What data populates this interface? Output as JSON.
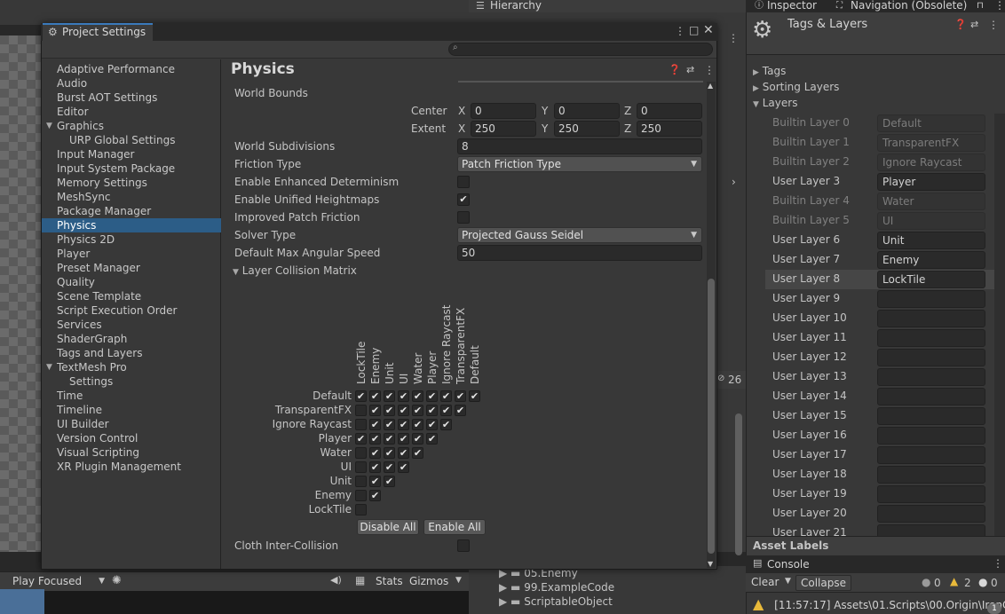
{
  "hierarchy": {
    "tab": "Hierarchy"
  },
  "inspector": {
    "tabs": [
      "Inspector",
      "Navigation (Obsolete)"
    ],
    "header_title": "Tags & Layers",
    "sections": [
      "Tags",
      "Sorting Layers",
      "Layers"
    ],
    "layers": [
      {
        "label": "Builtin Layer 0",
        "value": "Default",
        "builtin": true
      },
      {
        "label": "Builtin Layer 1",
        "value": "TransparentFX",
        "builtin": true
      },
      {
        "label": "Builtin Layer 2",
        "value": "Ignore Raycast",
        "builtin": true
      },
      {
        "label": "User Layer 3",
        "value": "Player",
        "builtin": false
      },
      {
        "label": "Builtin Layer 4",
        "value": "Water",
        "builtin": true
      },
      {
        "label": "Builtin Layer 5",
        "value": "UI",
        "builtin": true
      },
      {
        "label": "User Layer 6",
        "value": "Unit",
        "builtin": false
      },
      {
        "label": "User Layer 7",
        "value": "Enemy",
        "builtin": false
      },
      {
        "label": "User Layer 8",
        "value": "LockTile",
        "builtin": false
      },
      {
        "label": "User Layer 9",
        "value": "",
        "builtin": false
      },
      {
        "label": "User Layer 10",
        "value": "",
        "builtin": false
      },
      {
        "label": "User Layer 11",
        "value": "",
        "builtin": false
      },
      {
        "label": "User Layer 12",
        "value": "",
        "builtin": false
      },
      {
        "label": "User Layer 13",
        "value": "",
        "builtin": false
      },
      {
        "label": "User Layer 14",
        "value": "",
        "builtin": false
      },
      {
        "label": "User Layer 15",
        "value": "",
        "builtin": false
      },
      {
        "label": "User Layer 16",
        "value": "",
        "builtin": false
      },
      {
        "label": "User Layer 17",
        "value": "",
        "builtin": false
      },
      {
        "label": "User Layer 18",
        "value": "",
        "builtin": false
      },
      {
        "label": "User Layer 19",
        "value": "",
        "builtin": false
      },
      {
        "label": "User Layer 20",
        "value": "",
        "builtin": false
      },
      {
        "label": "User Layer 21",
        "value": "",
        "builtin": false
      }
    ],
    "highlighted_layer": "User Layer 8",
    "asset_labels": "Asset Labels"
  },
  "console": {
    "tab": "Console",
    "clear": "Clear",
    "collapse": "Collapse",
    "counts": {
      "info": "0",
      "warn": "2",
      "error": "0"
    },
    "entry": "[11:57:17] Assets\\01.Scripts\\00.Origin\\IronCo",
    "entry_count": "1"
  },
  "hierarchy_lower": {
    "count": "26"
  },
  "project_files": [
    "05.Enemy",
    "99.ExampleCode",
    "ScriptableObject"
  ],
  "game_toolbar": {
    "play_mode": "Play Focused",
    "stats": "Stats",
    "gizmos": "Gizmos"
  },
  "project_settings": {
    "window_title": "Project Settings",
    "search_placeholder": "",
    "nav": [
      {
        "label": "Adaptive Performance",
        "indent": 0
      },
      {
        "label": "Audio",
        "indent": 0
      },
      {
        "label": "Burst AOT Settings",
        "indent": 0
      },
      {
        "label": "Editor",
        "indent": 0
      },
      {
        "label": "Graphics",
        "indent": 0,
        "expandable": true
      },
      {
        "label": "URP Global Settings",
        "indent": 1
      },
      {
        "label": "Input Manager",
        "indent": 0
      },
      {
        "label": "Input System Package",
        "indent": 0
      },
      {
        "label": "Memory Settings",
        "indent": 0
      },
      {
        "label": "MeshSync",
        "indent": 0
      },
      {
        "label": "Package Manager",
        "indent": 0
      },
      {
        "label": "Physics",
        "indent": 0,
        "selected": true
      },
      {
        "label": "Physics 2D",
        "indent": 0
      },
      {
        "label": "Player",
        "indent": 0
      },
      {
        "label": "Preset Manager",
        "indent": 0
      },
      {
        "label": "Quality",
        "indent": 0
      },
      {
        "label": "Scene Template",
        "indent": 0
      },
      {
        "label": "Script Execution Order",
        "indent": 0
      },
      {
        "label": "Services",
        "indent": 0
      },
      {
        "label": "ShaderGraph",
        "indent": 0
      },
      {
        "label": "Tags and Layers",
        "indent": 0
      },
      {
        "label": "TextMesh Pro",
        "indent": 0,
        "expandable": true
      },
      {
        "label": "Settings",
        "indent": 1
      },
      {
        "label": "Time",
        "indent": 0
      },
      {
        "label": "Timeline",
        "indent": 0
      },
      {
        "label": "UI Builder",
        "indent": 0
      },
      {
        "label": "Version Control",
        "indent": 0
      },
      {
        "label": "Visual Scripting",
        "indent": 0
      },
      {
        "label": "XR Plugin Management",
        "indent": 0
      }
    ],
    "page_title": "Physics",
    "world_bounds": {
      "label": "World Bounds",
      "center_label": "Center",
      "extent_label": "Extent",
      "center": {
        "x": "0",
        "y": "0",
        "z": "0"
      },
      "extent": {
        "x": "250",
        "y": "250",
        "z": "250"
      }
    },
    "axes": {
      "x": "X",
      "y": "Y",
      "z": "Z"
    },
    "world_subdivisions": {
      "label": "World Subdivisions",
      "value": "8"
    },
    "friction_type": {
      "label": "Friction Type",
      "value": "Patch Friction Type"
    },
    "enhanced_determinism": {
      "label": "Enable Enhanced Determinism",
      "checked": false
    },
    "unified_heightmaps": {
      "label": "Enable Unified Heightmaps",
      "checked": true
    },
    "improved_patch_friction": {
      "label": "Improved Patch Friction",
      "checked": false
    },
    "solver_type": {
      "label": "Solver Type",
      "value": "Projected Gauss Seidel"
    },
    "max_angular_speed": {
      "label": "Default Max Angular Speed",
      "value": "50"
    },
    "collision_matrix": {
      "label": "Layer Collision Matrix",
      "rows": [
        "Default",
        "TransparentFX",
        "Ignore Raycast",
        "Player",
        "Water",
        "UI",
        "Unit",
        "Enemy",
        "LockTile"
      ],
      "columns": [
        "LockTile",
        "Enemy",
        "Unit",
        "UI",
        "Water",
        "Player",
        "Ignore Raycast",
        "TransparentFX",
        "Default"
      ],
      "checks": [
        [
          1,
          1,
          1,
          1,
          1,
          1,
          1,
          1,
          1
        ],
        [
          0,
          1,
          1,
          1,
          1,
          1,
          1,
          1
        ],
        [
          0,
          1,
          1,
          1,
          1,
          1,
          1
        ],
        [
          1,
          1,
          1,
          1,
          1,
          1
        ],
        [
          0,
          1,
          1,
          1,
          1
        ],
        [
          0,
          1,
          1,
          1
        ],
        [
          0,
          1,
          1
        ],
        [
          0,
          1
        ],
        [
          0
        ]
      ],
      "disable_all": "Disable All",
      "enable_all": "Enable All"
    },
    "cloth_inter_collision": {
      "label": "Cloth Inter-Collision",
      "checked": false
    }
  }
}
